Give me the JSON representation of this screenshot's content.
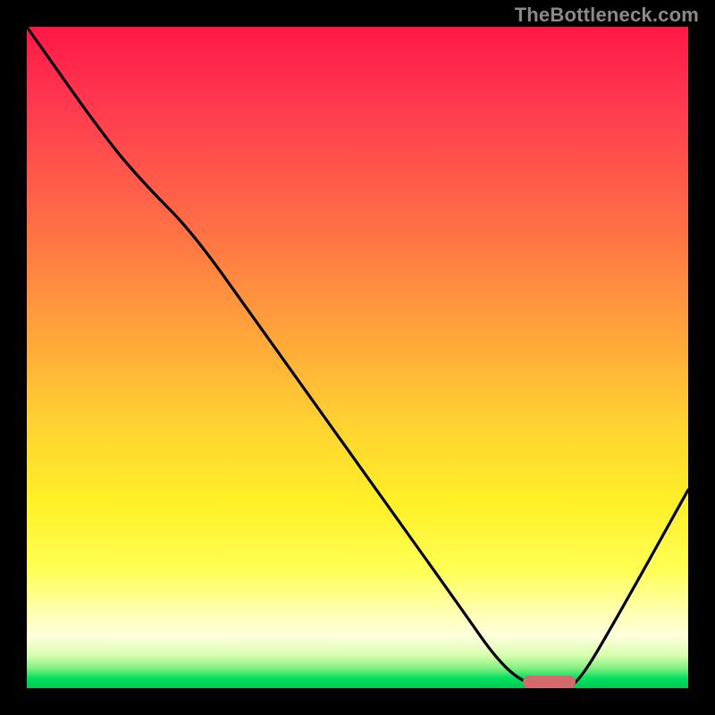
{
  "watermark": "TheBottleneck.com",
  "colors": {
    "curve_stroke": "#000000",
    "marker_fill": "#d46a6a",
    "background": "#000000"
  },
  "chart_data": {
    "type": "line",
    "title": "",
    "xlabel": "",
    "ylabel": "",
    "xlim": [
      0,
      100
    ],
    "ylim": [
      0,
      100
    ],
    "legend": false,
    "grid": false,
    "series": [
      {
        "name": "bottleneck-curve",
        "x": [
          0,
          12,
          18,
          25,
          35,
          45,
          55,
          65,
          72,
          77,
          80,
          83,
          90,
          100
        ],
        "values": [
          100,
          83,
          76,
          69,
          55,
          41,
          27,
          13,
          3,
          0,
          0,
          0,
          12,
          30
        ]
      }
    ],
    "annotations": [
      {
        "name": "optimal-range-marker",
        "x_start": 75,
        "x_end": 83,
        "y": 0
      }
    ],
    "gradient_stops": [
      {
        "pos": 0.0,
        "color": "#ff1846",
        "meaning": "high-bottleneck"
      },
      {
        "pos": 0.5,
        "color": "#ffb030",
        "meaning": "medium-bottleneck"
      },
      {
        "pos": 0.82,
        "color": "#ffff55",
        "meaning": "low-bottleneck"
      },
      {
        "pos": 1.0,
        "color": "#00c850",
        "meaning": "no-bottleneck"
      }
    ]
  }
}
